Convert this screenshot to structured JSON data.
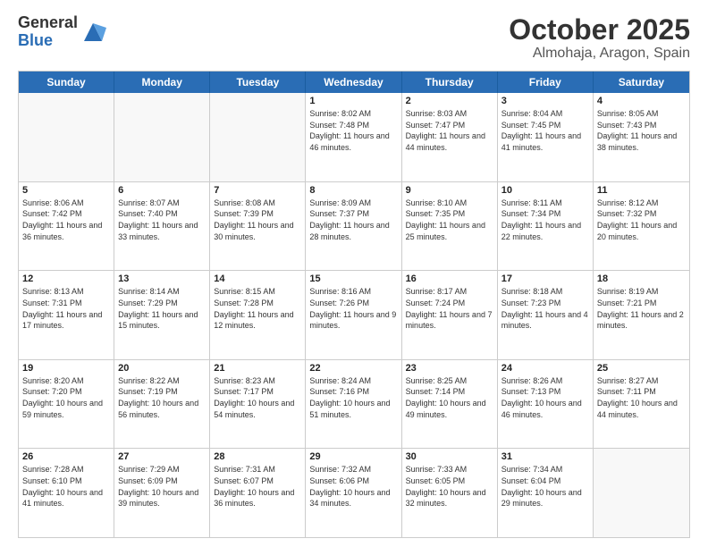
{
  "logo": {
    "general": "General",
    "blue": "Blue"
  },
  "header": {
    "month": "October 2025",
    "location": "Almohaja, Aragon, Spain"
  },
  "weekdays": [
    "Sunday",
    "Monday",
    "Tuesday",
    "Wednesday",
    "Thursday",
    "Friday",
    "Saturday"
  ],
  "rows": [
    [
      {
        "day": "",
        "empty": true
      },
      {
        "day": "",
        "empty": true
      },
      {
        "day": "",
        "empty": true
      },
      {
        "day": "1",
        "sunrise": "8:02 AM",
        "sunset": "7:48 PM",
        "daylight": "11 hours and 46 minutes."
      },
      {
        "day": "2",
        "sunrise": "8:03 AM",
        "sunset": "7:47 PM",
        "daylight": "11 hours and 44 minutes."
      },
      {
        "day": "3",
        "sunrise": "8:04 AM",
        "sunset": "7:45 PM",
        "daylight": "11 hours and 41 minutes."
      },
      {
        "day": "4",
        "sunrise": "8:05 AM",
        "sunset": "7:43 PM",
        "daylight": "11 hours and 38 minutes."
      }
    ],
    [
      {
        "day": "5",
        "sunrise": "8:06 AM",
        "sunset": "7:42 PM",
        "daylight": "11 hours and 36 minutes."
      },
      {
        "day": "6",
        "sunrise": "8:07 AM",
        "sunset": "7:40 PM",
        "daylight": "11 hours and 33 minutes."
      },
      {
        "day": "7",
        "sunrise": "8:08 AM",
        "sunset": "7:39 PM",
        "daylight": "11 hours and 30 minutes."
      },
      {
        "day": "8",
        "sunrise": "8:09 AM",
        "sunset": "7:37 PM",
        "daylight": "11 hours and 28 minutes."
      },
      {
        "day": "9",
        "sunrise": "8:10 AM",
        "sunset": "7:35 PM",
        "daylight": "11 hours and 25 minutes."
      },
      {
        "day": "10",
        "sunrise": "8:11 AM",
        "sunset": "7:34 PM",
        "daylight": "11 hours and 22 minutes."
      },
      {
        "day": "11",
        "sunrise": "8:12 AM",
        "sunset": "7:32 PM",
        "daylight": "11 hours and 20 minutes."
      }
    ],
    [
      {
        "day": "12",
        "sunrise": "8:13 AM",
        "sunset": "7:31 PM",
        "daylight": "11 hours and 17 minutes."
      },
      {
        "day": "13",
        "sunrise": "8:14 AM",
        "sunset": "7:29 PM",
        "daylight": "11 hours and 15 minutes."
      },
      {
        "day": "14",
        "sunrise": "8:15 AM",
        "sunset": "7:28 PM",
        "daylight": "11 hours and 12 minutes."
      },
      {
        "day": "15",
        "sunrise": "8:16 AM",
        "sunset": "7:26 PM",
        "daylight": "11 hours and 9 minutes."
      },
      {
        "day": "16",
        "sunrise": "8:17 AM",
        "sunset": "7:24 PM",
        "daylight": "11 hours and 7 minutes."
      },
      {
        "day": "17",
        "sunrise": "8:18 AM",
        "sunset": "7:23 PM",
        "daylight": "11 hours and 4 minutes."
      },
      {
        "day": "18",
        "sunrise": "8:19 AM",
        "sunset": "7:21 PM",
        "daylight": "11 hours and 2 minutes."
      }
    ],
    [
      {
        "day": "19",
        "sunrise": "8:20 AM",
        "sunset": "7:20 PM",
        "daylight": "10 hours and 59 minutes."
      },
      {
        "day": "20",
        "sunrise": "8:22 AM",
        "sunset": "7:19 PM",
        "daylight": "10 hours and 56 minutes."
      },
      {
        "day": "21",
        "sunrise": "8:23 AM",
        "sunset": "7:17 PM",
        "daylight": "10 hours and 54 minutes."
      },
      {
        "day": "22",
        "sunrise": "8:24 AM",
        "sunset": "7:16 PM",
        "daylight": "10 hours and 51 minutes."
      },
      {
        "day": "23",
        "sunrise": "8:25 AM",
        "sunset": "7:14 PM",
        "daylight": "10 hours and 49 minutes."
      },
      {
        "day": "24",
        "sunrise": "8:26 AM",
        "sunset": "7:13 PM",
        "daylight": "10 hours and 46 minutes."
      },
      {
        "day": "25",
        "sunrise": "8:27 AM",
        "sunset": "7:11 PM",
        "daylight": "10 hours and 44 minutes."
      }
    ],
    [
      {
        "day": "26",
        "sunrise": "7:28 AM",
        "sunset": "6:10 PM",
        "daylight": "10 hours and 41 minutes."
      },
      {
        "day": "27",
        "sunrise": "7:29 AM",
        "sunset": "6:09 PM",
        "daylight": "10 hours and 39 minutes."
      },
      {
        "day": "28",
        "sunrise": "7:31 AM",
        "sunset": "6:07 PM",
        "daylight": "10 hours and 36 minutes."
      },
      {
        "day": "29",
        "sunrise": "7:32 AM",
        "sunset": "6:06 PM",
        "daylight": "10 hours and 34 minutes."
      },
      {
        "day": "30",
        "sunrise": "7:33 AM",
        "sunset": "6:05 PM",
        "daylight": "10 hours and 32 minutes."
      },
      {
        "day": "31",
        "sunrise": "7:34 AM",
        "sunset": "6:04 PM",
        "daylight": "10 hours and 29 minutes."
      },
      {
        "day": "",
        "empty": true
      }
    ]
  ]
}
